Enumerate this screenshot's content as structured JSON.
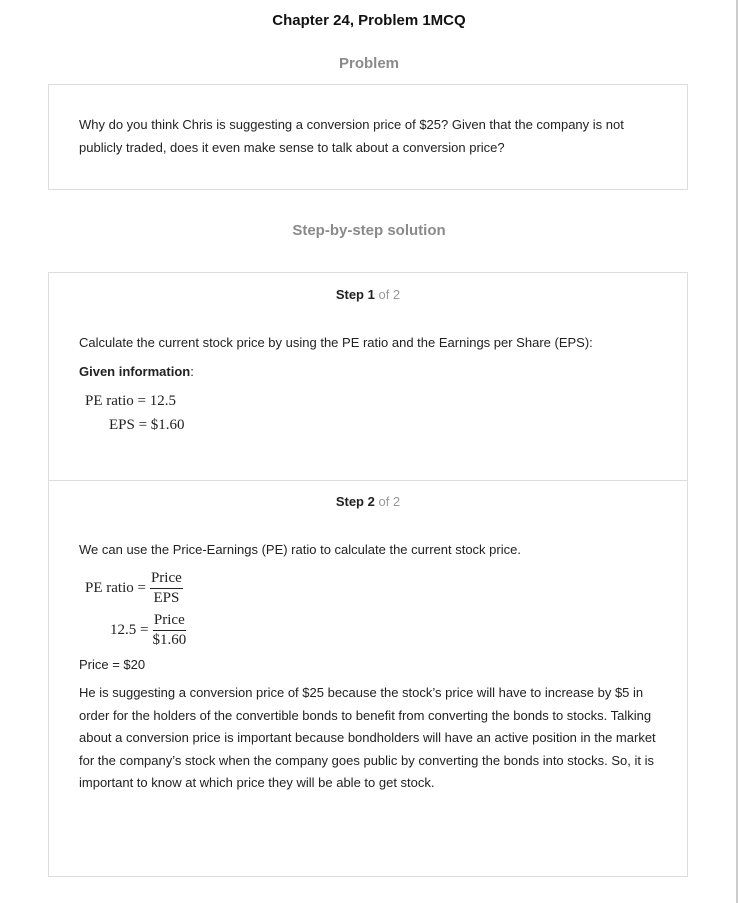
{
  "title": "Chapter 24, Problem 1MCQ",
  "problem_heading": "Problem",
  "problem_text": "Why do you think Chris is suggesting a conversion price of $25? Given that the company is not publicly traded, does it even make sense to talk about a conversion price?",
  "solution_heading": "Step-by-step solution",
  "steps": [
    {
      "label": "Step 1",
      "of": "of 2",
      "intro": "Calculate the current stock price by using the PE ratio and the Earnings per Share (EPS):",
      "given_label": "Given information",
      "given_colon": ":",
      "eq1": "PE ratio = 12.5",
      "eq2": "EPS = $1.60"
    },
    {
      "label": "Step 2",
      "of": "of 2",
      "intro": "We can use the Price-Earnings (PE) ratio to calculate the current stock price.",
      "f1_lhs": "PE ratio =",
      "f1_num": "Price",
      "f1_den": "EPS",
      "f2_lhs": "12.5 =",
      "f2_num": "Price",
      "f2_den": "$1.60",
      "result": "Price = $20",
      "explanation": "He is suggesting a conversion price of $25 because the stock’s price will have to increase by $5 in order for the holders of the convertible bonds to benefit from converting the bonds to stocks. Talking about a conversion price is important because bondholders will have an active position in the market for the company’s stock when the company goes public by converting the bonds into stocks. So, it is important to know at which price they will be able to get stock."
    }
  ]
}
